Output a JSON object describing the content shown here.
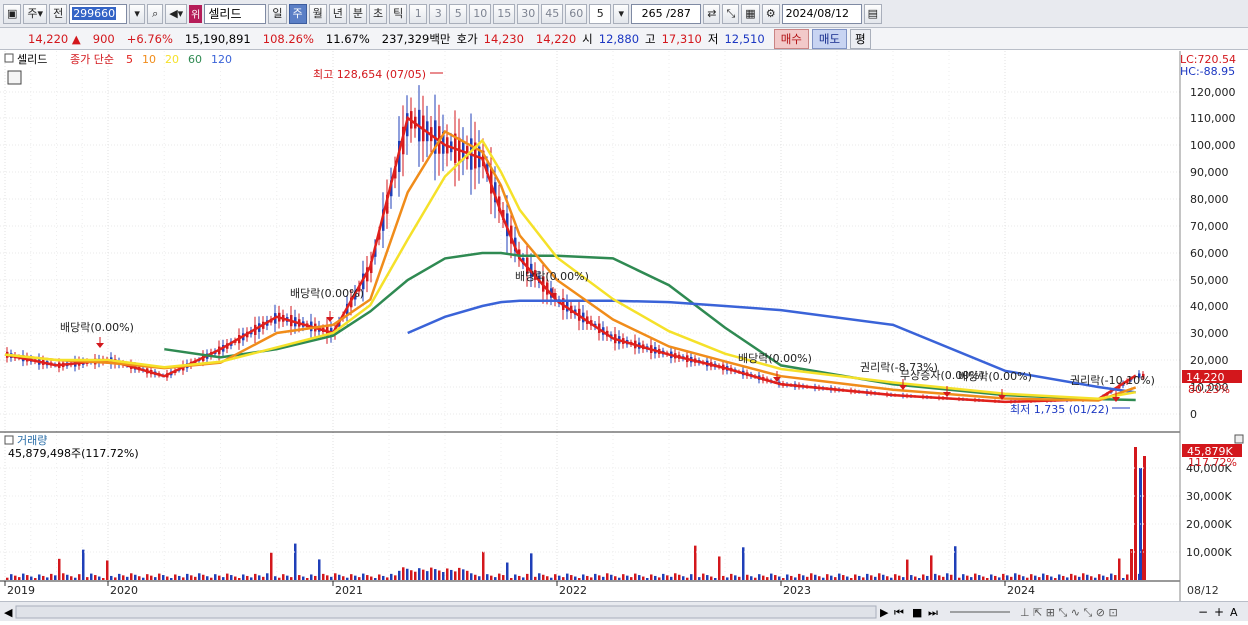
{
  "toolbar": {
    "mode_label": "주",
    "prev_label": "전",
    "stock_code": "299660",
    "badge": "위",
    "stock_name": "셀리드",
    "periods": [
      "일",
      "주",
      "월",
      "년",
      "분",
      "초",
      "틱"
    ],
    "selected_period": "주",
    "multipliers": [
      "1",
      "3",
      "5",
      "10",
      "15",
      "30",
      "45",
      "60"
    ],
    "count_value": "5",
    "page_counter": "265 /287",
    "date": "2024/08/12"
  },
  "quote": {
    "price": "14,220",
    "arrow": "▲",
    "change": "900",
    "change_pct": "+6.76%",
    "volume": "15,190,891",
    "volume_ratio": "108.26%",
    "turnover": "11.67%",
    "amount": "237,329백만",
    "bid_label": "호가",
    "bid1": "14,230",
    "bid2": "14,220",
    "open_label": "시",
    "open": "12,880",
    "high_label": "고",
    "high": "17,310",
    "low_label": "저",
    "low": "12,510",
    "buy_label": "매수",
    "sell_label": "매도",
    "avg_label": "평"
  },
  "price_panel": {
    "title": "셀리드",
    "legend_prefix": "종가 단순",
    "ma_periods": [
      "5",
      "10",
      "20",
      "60",
      "120"
    ],
    "lc_label": "LC:720.54",
    "hc_label": "HC:-88.95",
    "current_price_tag": "14,220",
    "current_pct_tag": "80.23%",
    "high_annotation": "최고 128,654 (07/05)",
    "low_annotation": "최저 1,735 (01/22)",
    "events": [
      "배당락(0.00%)",
      "배당락(0.00%)",
      "배당락(0.00%)",
      "배당락(0.00%)",
      "권리락(-8.73%)",
      "무상증자(0.00%)",
      "배당락(0.00%)",
      "권리락(-10.10%)"
    ]
  },
  "volume_panel": {
    "title": "거래량",
    "value": "45,879,498주(117.72%)",
    "value_tag": "45,879K",
    "pct_tag": "117.72%",
    "y_ticks": [
      "10,000K",
      "20,000K",
      "30,000K",
      "40,000K"
    ]
  },
  "x_axis": {
    "labels": [
      "2019",
      "2020",
      "2021",
      "2022",
      "2023",
      "2024"
    ],
    "last_date": "08/12"
  },
  "colors": {
    "up": "#d3171c",
    "down": "#1f3fb8",
    "ma5": "#e0201c",
    "ma10": "#f08c1a",
    "ma20": "#f5e12a",
    "ma60": "#2f8a52",
    "ma120": "#3a63d8"
  },
  "chart_data": {
    "type": "line",
    "title": "",
    "x": [
      "2019-01",
      "2019-07",
      "2020-01",
      "2020-04",
      "2020-07",
      "2020-10",
      "2021-01",
      "2021-03",
      "2021-05",
      "2021-07",
      "2021-09",
      "2021-10",
      "2021-11",
      "2022-01",
      "2022-04",
      "2022-07",
      "2022-10",
      "2023-01",
      "2023-07",
      "2024-01",
      "2024-06",
      "2024-08"
    ],
    "series": [
      {
        "name": "5",
        "values": [
          22000,
          18000,
          20000,
          14000,
          24000,
          36000,
          30000,
          55000,
          110000,
          100000,
          95000,
          75000,
          58000,
          42000,
          28000,
          22000,
          17000,
          11000,
          7000,
          4500,
          5500,
          14220
        ]
      },
      {
        "name": "60",
        "values": [
          null,
          null,
          null,
          24000,
          21000,
          24000,
          29000,
          38000,
          50000,
          58000,
          60000,
          60000,
          59000,
          59000,
          58000,
          48000,
          32000,
          18000,
          11000,
          7000,
          5500,
          5200
        ]
      },
      {
        "name": "120",
        "values": [
          null,
          null,
          null,
          null,
          null,
          null,
          null,
          null,
          30000,
          36000,
          40000,
          41500,
          42000,
          42000,
          42000,
          41500,
          40000,
          38500,
          33000,
          16000,
          10000,
          8000
        ]
      }
    ],
    "ylim": [
      0,
      128654
    ],
    "y_ticks": [
      0,
      10000,
      20000,
      30000,
      40000,
      50000,
      60000,
      70000,
      80000,
      90000,
      100000,
      110000,
      120000
    ],
    "volume": {
      "peak_value": 45879498,
      "ylim": [
        0,
        45879498
      ]
    }
  }
}
